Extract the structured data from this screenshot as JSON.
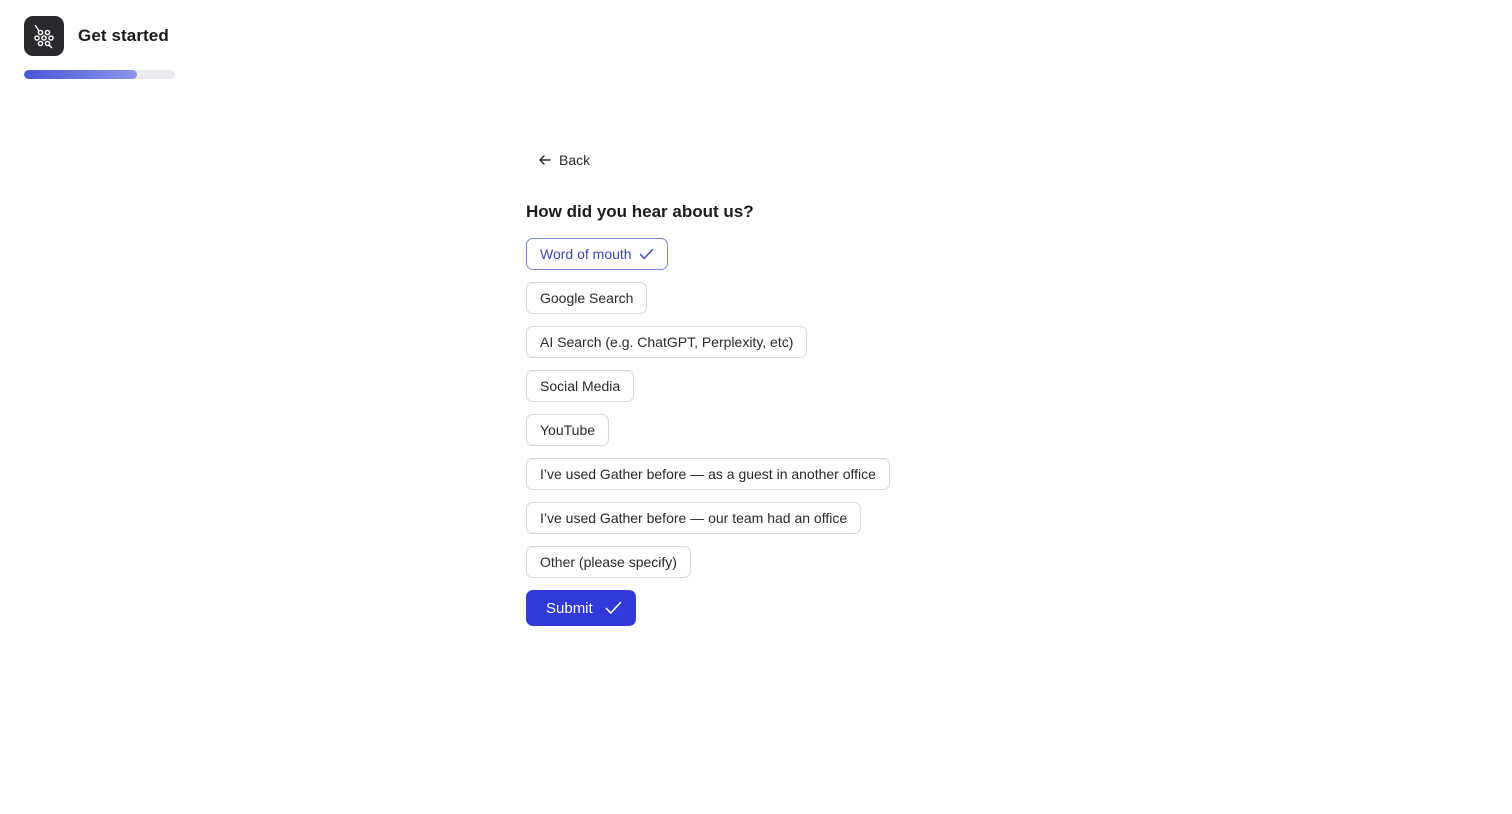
{
  "header": {
    "title": "Get started",
    "logo_icon": "graph-nodes-icon"
  },
  "progress": {
    "fraction": 0.75,
    "color_start": "#4a56d6",
    "color_end": "#8c96ec"
  },
  "back": {
    "label": "Back",
    "icon": "arrow-left-icon"
  },
  "question": {
    "text": "How did you hear about us?"
  },
  "options": [
    {
      "label": "Word of mouth",
      "selected": true
    },
    {
      "label": "Google Search",
      "selected": false
    },
    {
      "label": "AI Search (e.g. ChatGPT, Perplexity, etc)",
      "selected": false
    },
    {
      "label": "Social Media",
      "selected": false
    },
    {
      "label": "YouTube",
      "selected": false
    },
    {
      "label": "I’ve used Gather before — as a guest in another office",
      "selected": false
    },
    {
      "label": "I’ve used Gather before — our team had an office",
      "selected": false
    },
    {
      "label": "Other (please specify)",
      "selected": false
    }
  ],
  "submit": {
    "label": "Submit",
    "icon": "check-icon",
    "color": "#3139d8"
  },
  "colors": {
    "accent": "#3a44c8",
    "selected_border": "#7b84e0",
    "option_border": "#d6d6dc"
  }
}
